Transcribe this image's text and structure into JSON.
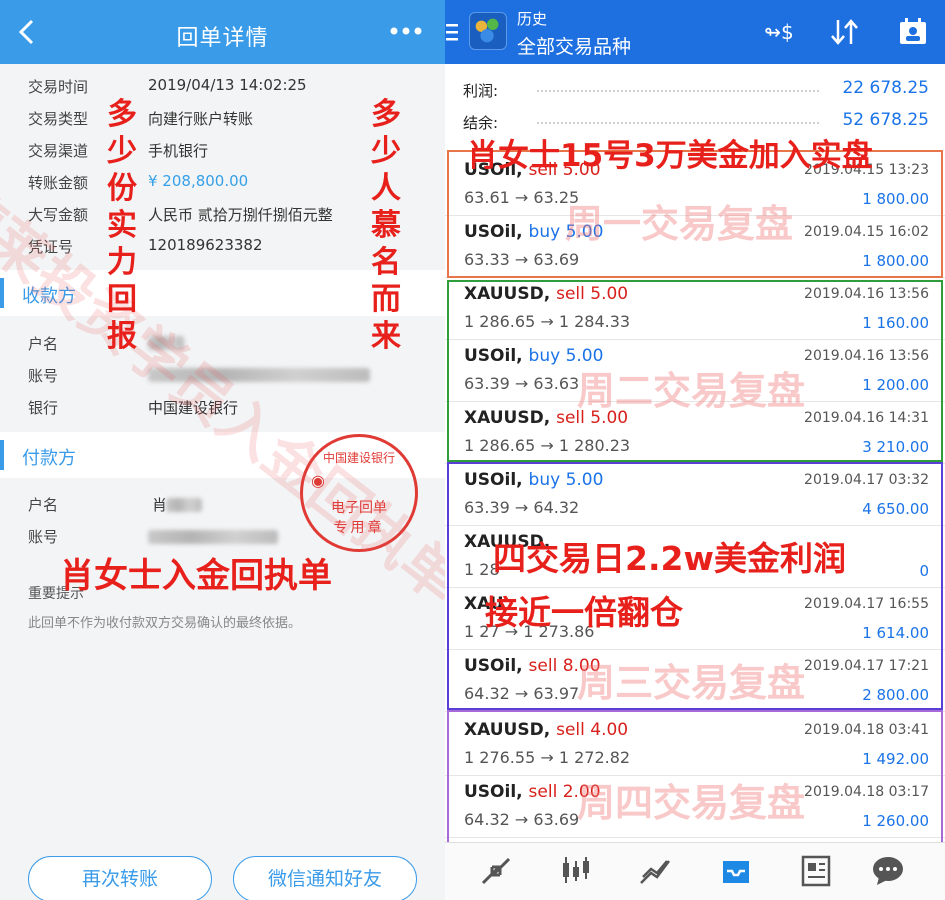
{
  "receipt": {
    "header_title": "回单详情",
    "fields": [
      {
        "k": "交易时间",
        "v": "2019/04/13 14:02:25"
      },
      {
        "k": "交易类型",
        "v": "向建行账户转账"
      },
      {
        "k": "交易渠道",
        "v": "手机银行"
      },
      {
        "k": "转账金额",
        "v": "¥ 208,800.00"
      },
      {
        "k": "大写金额",
        "v": "人民币 贰拾万捌仟捌佰元整"
      },
      {
        "k": "凭证号",
        "v": "120189623382"
      }
    ],
    "payee": {
      "title": "收款方",
      "name_label": "户名",
      "account_label": "账号",
      "bank_label": "银行",
      "bank_value": "中国建设银行"
    },
    "payer": {
      "title": "付款方",
      "name_label": "户名",
      "name_value": "肖",
      "account_label": "账号"
    },
    "notice_label": "重要提示",
    "notice_text": "此回单不作为收付款双方交易确认的最终依据。",
    "stamp": {
      "ring": "中国建设银行",
      "line1": "电子回单",
      "line2": "专用章"
    },
    "buttons": {
      "transfer_again": "再次转账",
      "wechat_notify": "微信通知好友"
    }
  },
  "overlay": {
    "left_vertical_1": "多少份实力回报",
    "left_vertical_2": "多少人慕名而来",
    "left_caption": "肖女士入金回执单",
    "left_watermark": "德莱投资学员入金回执单",
    "right_caption_top": "肖女士15号3万美金加入实盘",
    "right_caption_mid1": "四交易日2.2w美金利润",
    "right_caption_mid2": "接近一倍翻仓",
    "day_labels": [
      "周一交易复盘",
      "周二交易复盘",
      "周三交易复盘",
      "周四交易复盘"
    ]
  },
  "history": {
    "header_t1": "历史",
    "header_t2": "全部交易品种",
    "summary": [
      {
        "k": "利润:",
        "v": "22 678.25"
      },
      {
        "k": "结余:",
        "v": "52 678.25"
      }
    ],
    "trades": [
      {
        "sym": "USOil,",
        "side": "sell 5.00",
        "dir": "sell",
        "px": "63.61 → 63.25",
        "dt": "2019.04.15 13:23",
        "pl": "1 800.00"
      },
      {
        "sym": "USOil,",
        "side": "buy 5.00",
        "dir": "buy",
        "px": "63.33 → 63.69",
        "dt": "2019.04.15 16:02",
        "pl": "1 800.00"
      },
      {
        "sym": "XAUUSD,",
        "side": "sell 5.00",
        "dir": "sell",
        "px": "1 286.65 → 1 284.33",
        "dt": "2019.04.16 13:56",
        "pl": "1 160.00"
      },
      {
        "sym": "USOil,",
        "side": "buy 5.00",
        "dir": "buy",
        "px": "63.39 → 63.63",
        "dt": "2019.04.16 13:56",
        "pl": "1 200.00"
      },
      {
        "sym": "XAUUSD,",
        "side": "sell 5.00",
        "dir": "sell",
        "px": "1 286.65 → 1 280.23",
        "dt": "2019.04.16 14:31",
        "pl": "3 210.00"
      },
      {
        "sym": "USOil,",
        "side": "buy 5.00",
        "dir": "buy",
        "px": "63.39 → 64.32",
        "dt": "2019.04.17 03:32",
        "pl": "4 650.00"
      },
      {
        "sym": "XAUUSD,",
        "side": "",
        "dir": "sell",
        "px": "1 28",
        "dt": "",
        "pl": "0"
      },
      {
        "sym": "XAU",
        "side": "",
        "dir": "sell",
        "px": "1 27 → 1 273.86",
        "dt": "2019.04.17 16:55",
        "pl": "1 614.00"
      },
      {
        "sym": "USOil,",
        "side": "sell 8.00",
        "dir": "sell",
        "px": "64.32 → 63.97",
        "dt": "2019.04.17 17:21",
        "pl": "2 800.00"
      },
      {
        "sym": "XAUUSD,",
        "side": "sell 4.00",
        "dir": "sell",
        "px": "1 276.55 → 1 272.82",
        "dt": "2019.04.18 03:41",
        "pl": "1 492.00"
      },
      {
        "sym": "USOil,",
        "side": "sell 2.00",
        "dir": "sell",
        "px": "64.32 → 63.69",
        "dt": "2019.04.18 03:17",
        "pl": "1 260.00"
      }
    ],
    "colors": {
      "group_mon": "#e8744a",
      "group_tue": "#2f9e3a",
      "group_wed": "#5a3fd6",
      "group_thu": "#a86ad8"
    },
    "nav_icons": [
      "trade-icon",
      "chart-icon",
      "quotes-icon",
      "history-icon",
      "news-icon",
      "chat-icon"
    ]
  }
}
